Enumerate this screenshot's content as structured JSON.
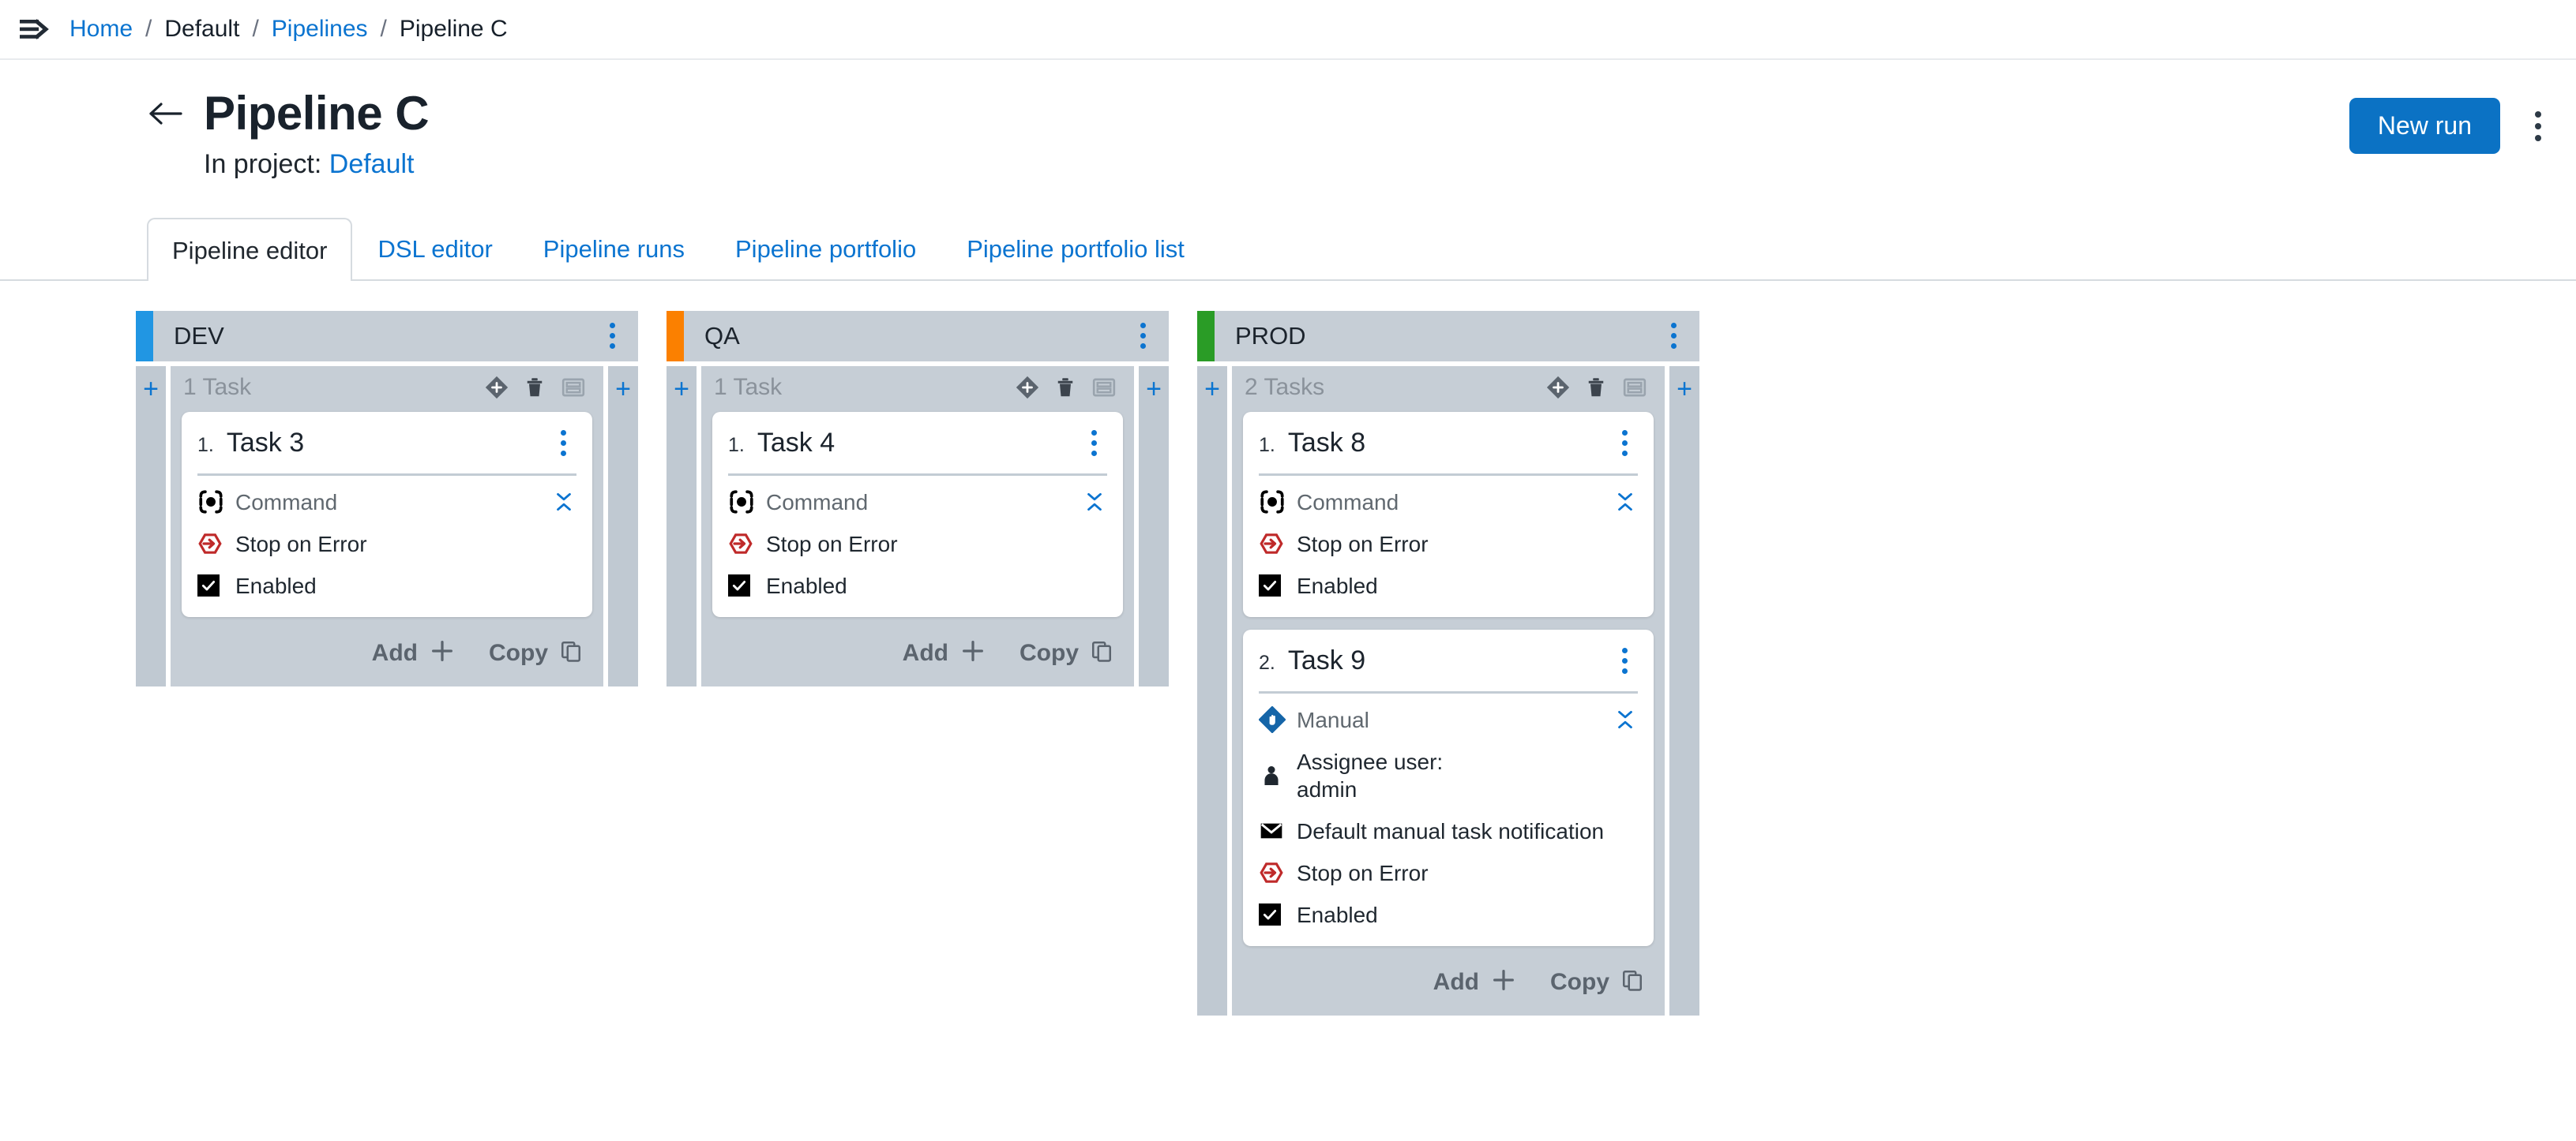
{
  "breadcrumb": {
    "menu_icon": "hamburger-arrow-icon",
    "items": [
      {
        "label": "Home",
        "link": true
      },
      {
        "label": "Default",
        "link": false
      },
      {
        "label": "Pipelines",
        "link": true
      },
      {
        "label": "Pipeline C",
        "link": false
      }
    ],
    "separator": "/"
  },
  "header": {
    "back_icon": "back-arrow-icon",
    "title": "Pipeline C",
    "subtitle_prefix": "In project:",
    "subtitle_link": "Default",
    "new_run_label": "New run",
    "more_icon": "kebab-menu-icon",
    "accent_color": "#0b72c4"
  },
  "tabs": [
    {
      "label": "Pipeline editor",
      "active": true
    },
    {
      "label": "DSL editor",
      "active": false
    },
    {
      "label": "Pipeline runs",
      "active": false
    },
    {
      "label": "Pipeline portfolio",
      "active": false
    },
    {
      "label": "Pipeline portfolio list",
      "active": false
    }
  ],
  "board": {
    "add_strip_icon": "plus-icon",
    "stage_icons": [
      {
        "name": "move-stage-icon"
      },
      {
        "name": "delete-stage-icon"
      },
      {
        "name": "collapse-stage-icon"
      }
    ],
    "footer": {
      "add_label": "Add",
      "add_icon": "plus-icon",
      "copy_label": "Copy",
      "copy_icon": "copy-icon"
    },
    "columns": [
      {
        "name": "DEV",
        "accent_color": "#2196e3",
        "task_count_label": "1 Task",
        "tasks": [
          {
            "index": "1.",
            "title": "Task 3",
            "type_label": "Command",
            "type_icon": "command-icon",
            "rows": [
              {
                "icon": "stop-on-error-icon",
                "label": "Stop on Error"
              },
              {
                "icon": "checkbox-checked-icon",
                "label": "Enabled"
              }
            ]
          }
        ]
      },
      {
        "name": "QA",
        "accent_color": "#fb8000",
        "task_count_label": "1 Task",
        "tasks": [
          {
            "index": "1.",
            "title": "Task 4",
            "type_label": "Command",
            "type_icon": "command-icon",
            "rows": [
              {
                "icon": "stop-on-error-icon",
                "label": "Stop on Error"
              },
              {
                "icon": "checkbox-checked-icon",
                "label": "Enabled"
              }
            ]
          }
        ]
      },
      {
        "name": "PROD",
        "accent_color": "#2a9c26",
        "task_count_label": "2 Tasks",
        "tasks": [
          {
            "index": "1.",
            "title": "Task 8",
            "type_label": "Command",
            "type_icon": "command-icon",
            "rows": [
              {
                "icon": "stop-on-error-icon",
                "label": "Stop on Error"
              },
              {
                "icon": "checkbox-checked-icon",
                "label": "Enabled"
              }
            ]
          },
          {
            "index": "2.",
            "title": "Task 9",
            "type_label": "Manual",
            "type_icon": "manual-hand-icon",
            "rows": [
              {
                "icon": "assignee-user-icon",
                "label": "Assignee user:",
                "label2": "admin"
              },
              {
                "icon": "mail-icon",
                "label": "Default manual task notification"
              },
              {
                "icon": "stop-on-error-icon",
                "label": "Stop on Error"
              },
              {
                "icon": "checkbox-checked-icon",
                "label": "Enabled"
              }
            ]
          }
        ]
      }
    ]
  }
}
